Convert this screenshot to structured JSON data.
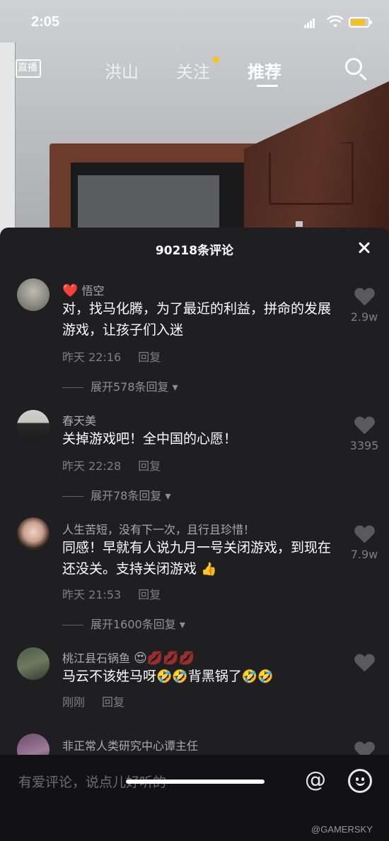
{
  "status_bar": {
    "time": "2:05"
  },
  "top_nav": {
    "live_label": "直播",
    "tabs": [
      {
        "label": "洪山",
        "active": false
      },
      {
        "label": "关注",
        "active": false,
        "has_dot": true
      },
      {
        "label": "推荐",
        "active": true
      }
    ]
  },
  "comments_panel": {
    "title": "90218条评论",
    "comments": [
      {
        "name_prefix": "❤️",
        "name": "悟空",
        "text": "对，找马化腾，为了最近的利益，拼命的发展游戏，让孩子们入迷",
        "time": "昨天 22:16",
        "reply": "回复",
        "likes": "2.9w",
        "expand": "展开578条回复"
      },
      {
        "name": "春天美",
        "text": "关掉游戏吧！全中国的心愿！",
        "time": "昨天 22:28",
        "reply": "回复",
        "likes": "3395",
        "expand": "展开78条回复"
      },
      {
        "name": "人生苦短，没有下一次，且行且珍惜！",
        "text": "同感！早就有人说九月一号关闭游戏，到现在还没关。支持关闭游戏",
        "text_emoji": "👍",
        "time": "昨天 21:53",
        "reply": "回复",
        "likes": "7.9w",
        "expand": "展开1600条回复"
      },
      {
        "name": "桃江县石锅鱼",
        "name_emoji": "😍💋💋💋",
        "text_a": "马云不该姓马呀",
        "text_emoji_a": "🤣🤣",
        "text_b": "背黑锅了",
        "text_emoji_b": "🤣🤣",
        "time": "刚刚",
        "reply": "回复",
        "likes": ""
      },
      {
        "name": "非正常人类研究中心谭主任"
      }
    ]
  },
  "input_bar": {
    "placeholder": "有爱评论，说点儿好听的~"
  },
  "watermark": "@GAMERSKY"
}
